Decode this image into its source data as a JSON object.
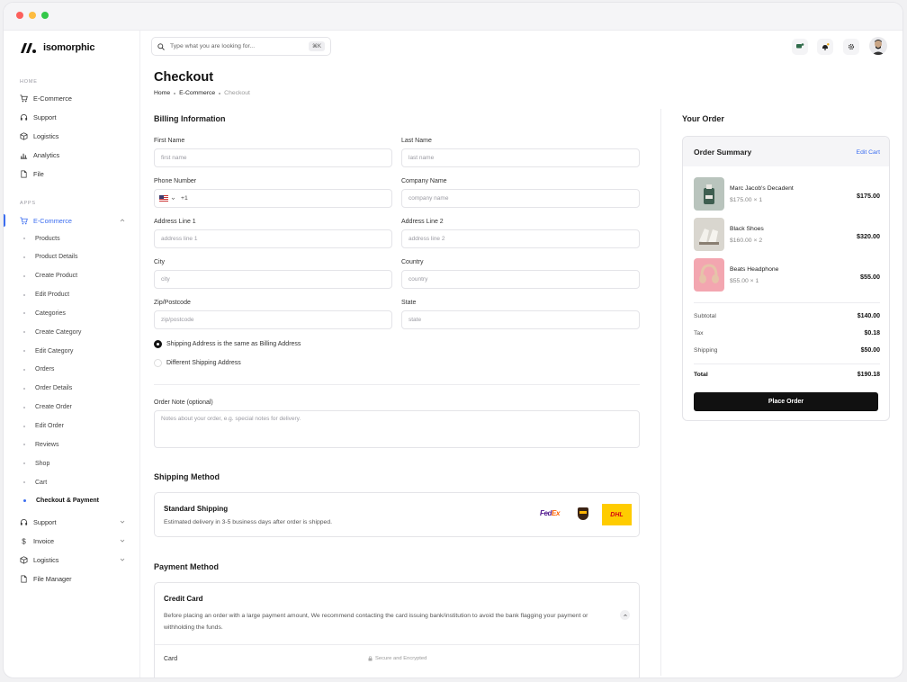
{
  "brand": {
    "name": "isomorphic"
  },
  "sidebar": {
    "home_label": "HOME",
    "apps_label": "APPS",
    "home_items": [
      {
        "label": "E-Commerce",
        "icon": "cart-icon"
      },
      {
        "label": "Support",
        "icon": "headset-icon"
      },
      {
        "label": "Logistics",
        "icon": "box-icon"
      },
      {
        "label": "Analytics",
        "icon": "bar-chart-icon"
      },
      {
        "label": "File",
        "icon": "file-icon"
      }
    ],
    "apps_active": {
      "label": "E-Commerce",
      "icon": "cart-icon"
    },
    "apps_subitems": [
      "Products",
      "Product Details",
      "Create Product",
      "Edit Product",
      "Categories",
      "Create Category",
      "Edit Category",
      "Orders",
      "Order Details",
      "Create Order",
      "Edit Order",
      "Reviews",
      "Shop",
      "Cart",
      "Checkout & Payment"
    ],
    "apps_more": [
      {
        "label": "Support",
        "icon": "headset-icon"
      },
      {
        "label": "Invoice",
        "icon": "dollar-icon"
      },
      {
        "label": "Logistics",
        "icon": "box-icon"
      },
      {
        "label": "File Manager",
        "icon": "file-icon"
      }
    ]
  },
  "search": {
    "placeholder": "Type what you are looking for...",
    "shortcut": "⌘K"
  },
  "page": {
    "title": "Checkout",
    "breadcrumb": [
      "Home",
      "E-Commerce",
      "Checkout"
    ]
  },
  "billing": {
    "title": "Billing Information",
    "first_name": {
      "label": "First Name",
      "placeholder": "first name"
    },
    "last_name": {
      "label": "Last Name",
      "placeholder": "last name"
    },
    "phone": {
      "label": "Phone Number",
      "code": "+1"
    },
    "company": {
      "label": "Company Name",
      "placeholder": "company name"
    },
    "address1": {
      "label": "Address Line 1",
      "placeholder": "address line 1"
    },
    "address2": {
      "label": "Address Line 2",
      "placeholder": "address line 2"
    },
    "city": {
      "label": "City",
      "placeholder": "city"
    },
    "country": {
      "label": "Country",
      "placeholder": "country"
    },
    "zip": {
      "label": "Zip/Postcode",
      "placeholder": "zip/postcode"
    },
    "state": {
      "label": "State",
      "placeholder": "state"
    },
    "same_address": "Shipping Address is the same as Billing Address",
    "different_address": "Different Shipping Address",
    "note": {
      "label": "Order Note (optional)",
      "placeholder": "Notes about your order, e.g. special notes for delivery."
    }
  },
  "shipping": {
    "title": "Shipping Method",
    "option_name": "Standard Shipping",
    "option_desc": "Estimated delivery in 3-5 business days after order is shipped.",
    "carriers": {
      "fedex_fe": "Fed",
      "fedex_ex": "Ex",
      "dhl": "DHL"
    }
  },
  "payment": {
    "title": "Payment Method",
    "method": "Credit Card",
    "description": "Before placing an order with a large payment amount, We recommend contacting the card issuing bank/institution to avoid the bank flagging your payment or withholding the funds.",
    "card_label": "Card",
    "secure_text": "Secure and Encrypted"
  },
  "order": {
    "title": "Your Order",
    "summary_title": "Order Summary",
    "edit_cart": "Edit Cart",
    "items": [
      {
        "name": "Marc Jacob's Decadent",
        "qty": "$175.00 × 1",
        "price": "$175.00",
        "thumb_color": "#b9c4bd"
      },
      {
        "name": "Black Shoes",
        "qty": "$160.00 × 2",
        "price": "$320.00",
        "thumb_color": "#d9d6cf"
      },
      {
        "name": "Beats Headphone",
        "qty": "$55.00 × 1",
        "price": "$55.00",
        "thumb_color": "#f3a6b0"
      }
    ],
    "subtotal_label": "Subtotal",
    "subtotal": "$140.00",
    "tax_label": "Tax",
    "tax": "$0.18",
    "shipping_label": "Shipping",
    "shipping": "$50.00",
    "total_label": "Total",
    "total": "$190.18",
    "place_order": "Place Order"
  },
  "colors": {
    "accent": "#3b6df0",
    "dark": "#111111"
  }
}
